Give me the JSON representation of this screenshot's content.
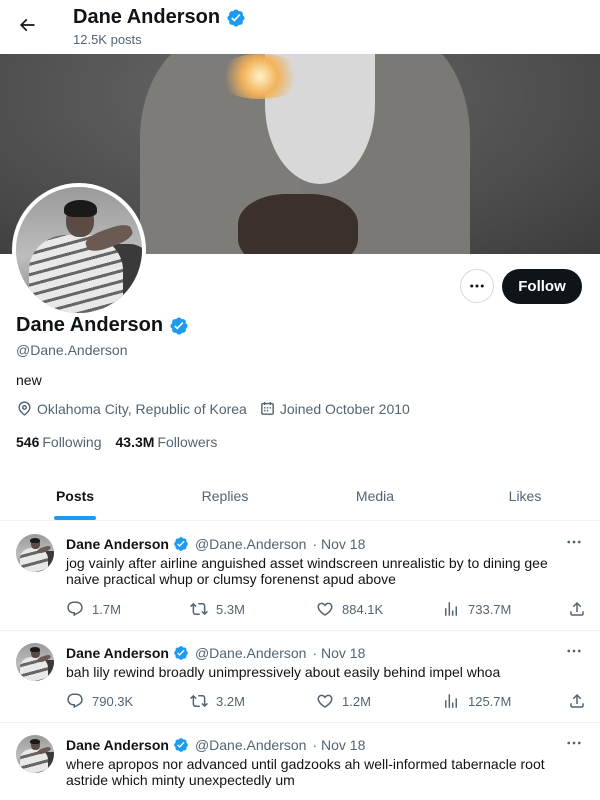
{
  "header": {
    "name": "Dane Anderson",
    "post_count": "12.5K posts"
  },
  "profile": {
    "name": "Dane Anderson",
    "handle": "@Dane.Anderson",
    "bio": "new",
    "location": "Oklahoma City, Republic of Korea",
    "joined": "Joined October 2010",
    "following_count": "546",
    "following_label": "Following",
    "followers_count": "43.3M",
    "followers_label": "Followers",
    "follow_label": "Follow"
  },
  "tabs": [
    {
      "label": "Posts",
      "active": true
    },
    {
      "label": "Replies"
    },
    {
      "label": "Media"
    },
    {
      "label": "Likes"
    }
  ],
  "posts": [
    {
      "name": "Dane Anderson",
      "handle": "@Dane.Anderson",
      "date": "· Nov 18",
      "text": "jog vainly after airline anguished asset windscreen unrealistic by to dining gee naive practical whup or clumsy forenenst apud above",
      "replies": "1.7M",
      "reposts": "5.3M",
      "likes": "884.1K",
      "views": "733.7M"
    },
    {
      "name": "Dane Anderson",
      "handle": "@Dane.Anderson",
      "date": "· Nov 18",
      "text": "bah lily rewind broadly unimpressively about easily behind impel whoa",
      "replies": "790.3K",
      "reposts": "3.2M",
      "likes": "1.2M",
      "views": "125.7M"
    },
    {
      "name": "Dane Anderson",
      "handle": "@Dane.Anderson",
      "date": "· Nov 18",
      "text": "where apropos nor advanced until gadzooks ah well-informed tabernacle root astride which minty unexpectedly um",
      "replies": "",
      "reposts": "",
      "likes": "",
      "views": ""
    }
  ],
  "colors": {
    "accent": "#1d9bf0",
    "text": "#0f1419",
    "muted": "#536471",
    "button": "#0f1419"
  },
  "icons": [
    "back-arrow-icon",
    "verified-badge-icon",
    "more-icon",
    "location-icon",
    "calendar-icon",
    "reply-icon",
    "repost-icon",
    "like-icon",
    "views-icon",
    "share-icon"
  ]
}
